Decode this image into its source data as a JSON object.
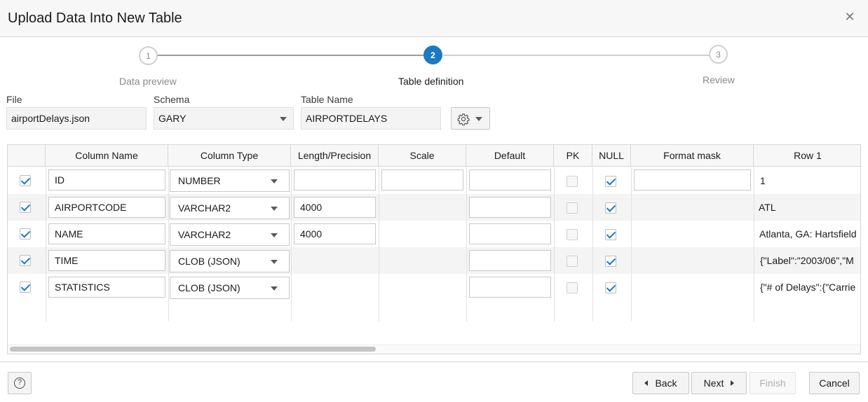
{
  "dialog": {
    "title": "Upload Data Into New Table"
  },
  "stepper": {
    "steps": [
      {
        "number": "1",
        "label": "Data preview",
        "state": "done"
      },
      {
        "number": "2",
        "label": "Table definition",
        "state": "active"
      },
      {
        "number": "3",
        "label": "Review",
        "state": "pending"
      }
    ]
  },
  "form": {
    "file_label": "File",
    "file_value": "airportDelays.json",
    "schema_label": "Schema",
    "schema_value": "GARY",
    "table_name_label": "Table Name",
    "table_name_value": "AIRPORTDELAYS"
  },
  "grid": {
    "columns": [
      "",
      "Column Name",
      "Column Type",
      "Length/Precision",
      "Scale",
      "Default",
      "PK",
      "NULL",
      "Format mask",
      "Row 1"
    ],
    "rows": [
      {
        "include": true,
        "name": "ID",
        "type": "NUMBER",
        "length": "",
        "pk": false,
        "nullable": true,
        "row1": "1"
      },
      {
        "include": true,
        "name": "AIRPORTCODE",
        "type": "VARCHAR2",
        "length": "4000",
        "pk": false,
        "nullable": true,
        "row1": "ATL"
      },
      {
        "include": true,
        "name": "NAME",
        "type": "VARCHAR2",
        "length": "4000",
        "pk": false,
        "nullable": true,
        "row1": " Atlanta, GA: Hartsfield"
      },
      {
        "include": true,
        "name": "TIME",
        "type": "CLOB (JSON)",
        "length": "",
        "pk": false,
        "nullable": true,
        "row1": "{\"Label\":\"2003/06\",\"M"
      },
      {
        "include": true,
        "name": "STATISTICS",
        "type": "CLOB (JSON)",
        "length": "",
        "pk": false,
        "nullable": true,
        "row1": "{\"# of Delays\":{\"Carrie"
      }
    ]
  },
  "footer": {
    "back_label": "Back",
    "next_label": "Next",
    "finish_label": "Finish",
    "cancel_label": "Cancel"
  },
  "colors": {
    "accent": "#1d7ac2"
  }
}
